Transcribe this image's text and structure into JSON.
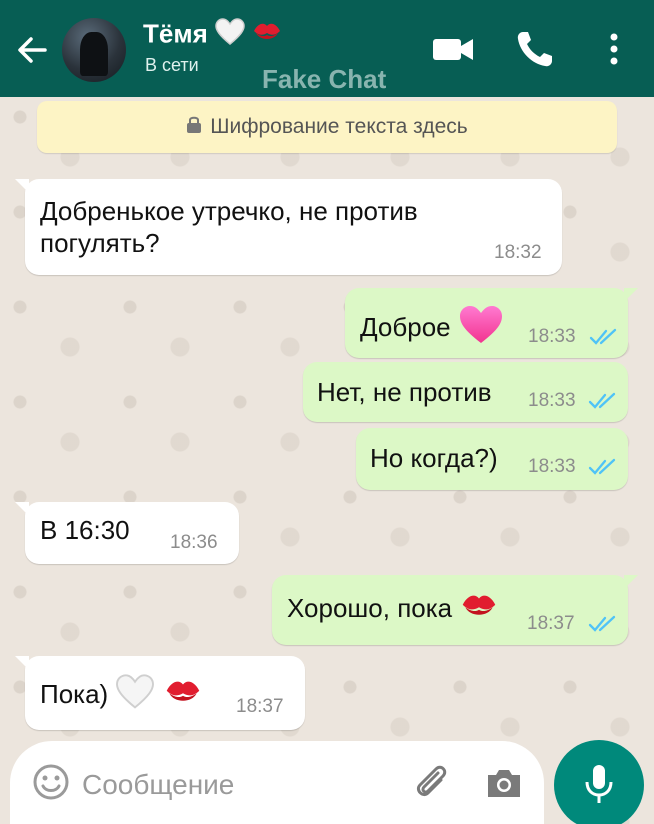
{
  "header": {
    "contact_name": "Тёмя",
    "status": "В сети",
    "watermark": "Fake Chat",
    "background_color": "#075e54",
    "icons": [
      "back-arrow-icon",
      "video-call-icon",
      "phone-icon",
      "more-vert-icon"
    ]
  },
  "encryption_notice": "Шифрование текста здесь",
  "messages": [
    {
      "direction": "in",
      "text_line1": "Добренькое утречко, не против",
      "text_line2": "погулять?",
      "time": "18:32"
    },
    {
      "direction": "out",
      "text": "Доброе",
      "emoji": "pink-heart",
      "time": "18:33",
      "read": true
    },
    {
      "direction": "out",
      "text": "Нет, не против",
      "time": "18:33",
      "read": true
    },
    {
      "direction": "out",
      "text": "Но когда?)",
      "time": "18:33",
      "read": true
    },
    {
      "direction": "in",
      "text": "В 16:30",
      "time": "18:36"
    },
    {
      "direction": "out",
      "text": "Хорошо, пока",
      "emoji": "kiss-mark",
      "time": "18:37",
      "read": true
    },
    {
      "direction": "in",
      "text": "Пока)",
      "emoji": "white-heart, kiss-mark",
      "time": "18:37"
    }
  ],
  "composer": {
    "placeholder": "Сообщение",
    "icons": [
      "emoji-icon",
      "attach-icon",
      "camera-icon",
      "mic-icon"
    ]
  },
  "colors": {
    "incoming_bubble": "#ffffff",
    "outgoing_bubble": "#dcf8c6",
    "read_ticks": "#4fc3f7",
    "fab": "#00897b"
  }
}
